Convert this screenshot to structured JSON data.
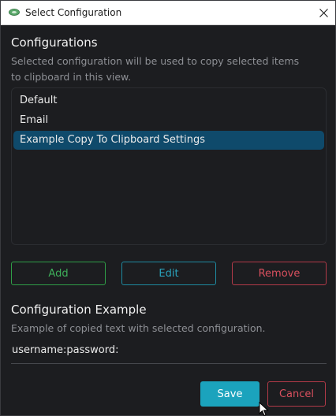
{
  "window": {
    "title": "Select Configuration"
  },
  "configurations": {
    "heading": "Configurations",
    "description_line1": "Selected configuration will be used to copy selected items",
    "description_line2": "to clipboard in this view.",
    "items": [
      {
        "label": "Default",
        "selected": false
      },
      {
        "label": "Email",
        "selected": false
      },
      {
        "label": "Example Copy To Clipboard Settings",
        "selected": true
      }
    ]
  },
  "actions": {
    "add": "Add",
    "edit": "Edit",
    "remove": "Remove"
  },
  "example": {
    "heading": "Configuration Example",
    "description": "Example of copied text with selected configuration.",
    "value": "username:password:"
  },
  "footer": {
    "save": "Save",
    "cancel": "Cancel"
  },
  "colors": {
    "selected_row": "#0f4a6b",
    "add": "#3eb05a",
    "edit": "#2aa3bd",
    "remove": "#d9505e",
    "save_bg": "#1ba3bd"
  }
}
